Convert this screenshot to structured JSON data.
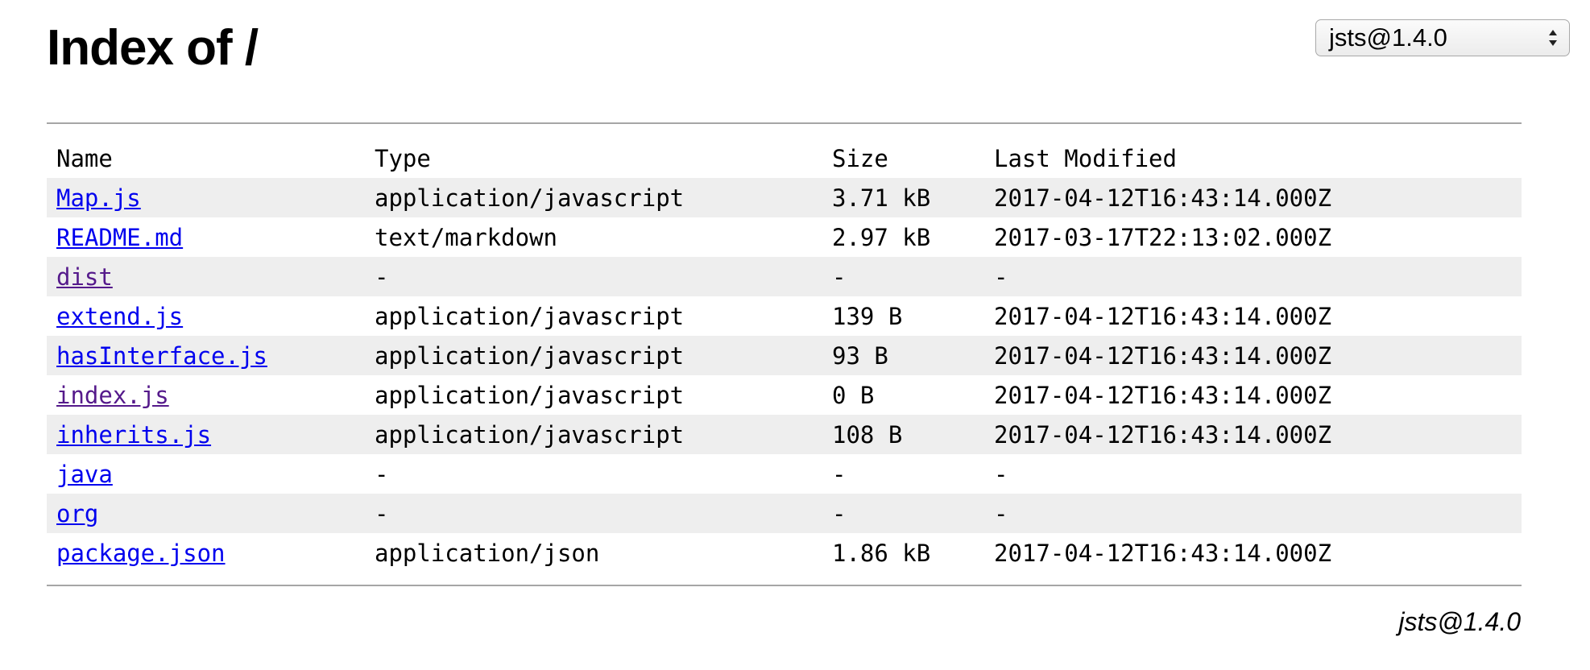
{
  "page": {
    "title": "Index of /",
    "version_select": {
      "selected": "jsts@1.4.0",
      "icon": "select-arrows-icon"
    },
    "footer_version": "jsts@1.4.0"
  },
  "table": {
    "headers": {
      "name": "Name",
      "type": "Type",
      "size": "Size",
      "last_modified": "Last Modified"
    },
    "rows": [
      {
        "name": "Map.js",
        "type": "application/javascript",
        "size": "3.71 kB",
        "last_modified": "2017-04-12T16:43:14.000Z",
        "visited": false
      },
      {
        "name": "README.md",
        "type": "text/markdown",
        "size": "2.97 kB",
        "last_modified": "2017-03-17T22:13:02.000Z",
        "visited": false
      },
      {
        "name": "dist",
        "type": "-",
        "size": "-",
        "last_modified": "-",
        "visited": true
      },
      {
        "name": "extend.js",
        "type": "application/javascript",
        "size": "139 B",
        "last_modified": "2017-04-12T16:43:14.000Z",
        "visited": false
      },
      {
        "name": "hasInterface.js",
        "type": "application/javascript",
        "size": "93 B",
        "last_modified": "2017-04-12T16:43:14.000Z",
        "visited": false
      },
      {
        "name": "index.js",
        "type": "application/javascript",
        "size": "0 B",
        "last_modified": "2017-04-12T16:43:14.000Z",
        "visited": true
      },
      {
        "name": "inherits.js",
        "type": "application/javascript",
        "size": "108 B",
        "last_modified": "2017-04-12T16:43:14.000Z",
        "visited": false
      },
      {
        "name": "java",
        "type": "-",
        "size": "-",
        "last_modified": "-",
        "visited": false
      },
      {
        "name": "org",
        "type": "-",
        "size": "-",
        "last_modified": "-",
        "visited": false
      },
      {
        "name": "package.json",
        "type": "application/json",
        "size": "1.86 kB",
        "last_modified": "2017-04-12T16:43:14.000Z",
        "visited": false
      }
    ]
  },
  "colors": {
    "link": "#0000ee",
    "visited_link": "#551a8b",
    "row_stripe": "#eeeeee",
    "rule": "#a6a6a6"
  }
}
